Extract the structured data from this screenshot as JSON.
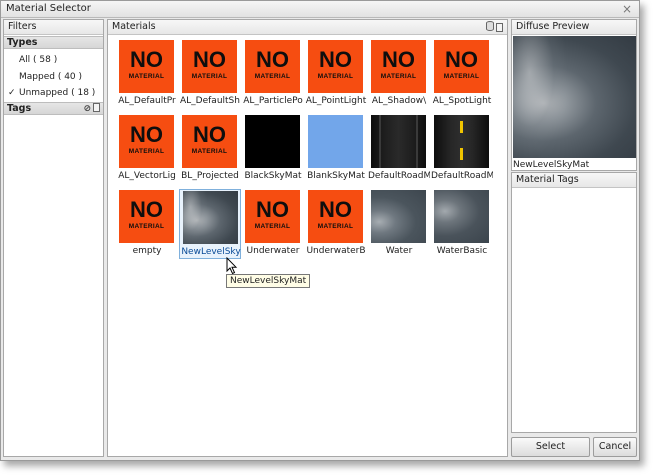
{
  "window": {
    "title": "Material Selector",
    "close_glyph": "×"
  },
  "filters": {
    "header": "Filters",
    "types_header": "Types",
    "types": [
      {
        "label": "All ( 58 )",
        "checked": false
      },
      {
        "label": "Mapped ( 40 )",
        "checked": false
      },
      {
        "label": "Unmapped ( 18 )",
        "checked": true
      }
    ],
    "check_glyph": "✓",
    "tags_header": "Tags",
    "tags_clear_glyph": "⊘"
  },
  "materials": {
    "header": "Materials",
    "no_material_big": "NO",
    "no_material_small": "MATERIAL",
    "items": [
      {
        "label": "AL_DefaultPr",
        "thumb": "nomat"
      },
      {
        "label": "AL_DefaultSh",
        "thumb": "nomat"
      },
      {
        "label": "AL_ParticlePo",
        "thumb": "nomat"
      },
      {
        "label": "AL_PointLight",
        "thumb": "nomat"
      },
      {
        "label": "AL_Shadow\\",
        "thumb": "nomat"
      },
      {
        "label": "AL_SpotLight",
        "thumb": "nomat"
      },
      {
        "label": "AL_VectorLig",
        "thumb": "nomat"
      },
      {
        "label": "BL_Projected",
        "thumb": "nomat"
      },
      {
        "label": "BlackSkyMat",
        "thumb": "black"
      },
      {
        "label": "BlankSkyMat",
        "thumb": "blue"
      },
      {
        "label": "DefaultRoadM",
        "thumb": "road"
      },
      {
        "label": "DefaultRoadM",
        "thumb": "roadm"
      },
      {
        "label": "empty",
        "thumb": "nomat"
      },
      {
        "label": "NewLevelSky",
        "thumb": "sky",
        "selected": true
      },
      {
        "label": "Underwater",
        "thumb": "nomat"
      },
      {
        "label": "UnderwaterB",
        "thumb": "nomat"
      },
      {
        "label": "Water",
        "thumb": "water"
      },
      {
        "label": "WaterBasic",
        "thumb": "waterb"
      }
    ],
    "tooltip": "NewLevelSkyMat"
  },
  "preview": {
    "header": "Diffuse Preview",
    "name": "NewLevelSkyMat"
  },
  "material_tags": {
    "header": "Material Tags"
  },
  "buttons": {
    "select": "Select",
    "cancel": "Cancel"
  },
  "colors": {
    "no_material": "#f64d11",
    "selection_border": "#7fb0dc"
  }
}
